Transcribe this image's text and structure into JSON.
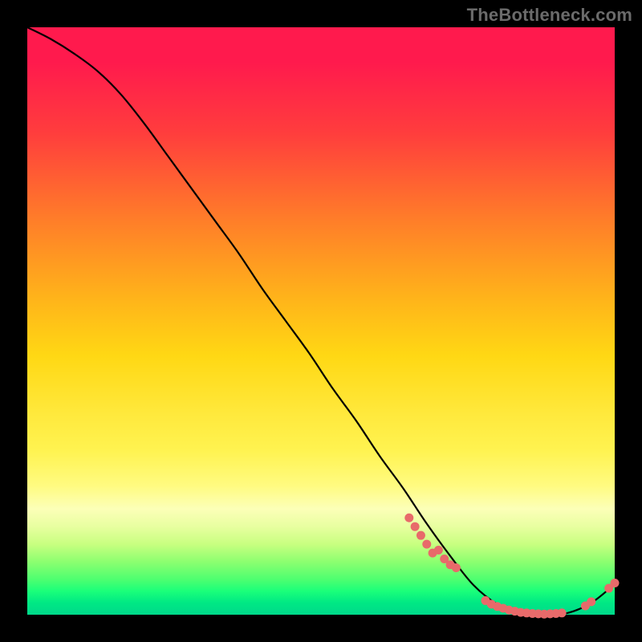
{
  "watermark": "TheBottleneck.com",
  "colors": {
    "curve": "#000000",
    "marker_fill": "#e86a6a",
    "marker_stroke": "#c84a4a",
    "bg": "#000000"
  },
  "chart_data": {
    "type": "line",
    "title": "",
    "xlabel": "",
    "ylabel": "",
    "xlim": [
      0,
      100
    ],
    "ylim": [
      0,
      100
    ],
    "grid": false,
    "legend": false,
    "series": [
      {
        "name": "bottleneck-curve",
        "x": [
          0,
          4,
          8,
          12,
          16,
          20,
          24,
          28,
          32,
          36,
          40,
          44,
          48,
          52,
          56,
          60,
          64,
          68,
          72,
          76,
          80,
          84,
          88,
          92,
          96,
          100
        ],
        "y": [
          100,
          98.0,
          95.5,
          92.5,
          88.5,
          83.5,
          78.0,
          72.5,
          67.0,
          61.5,
          55.5,
          50.0,
          44.5,
          38.5,
          33.0,
          27.0,
          21.5,
          15.5,
          10.0,
          5.0,
          1.8,
          0.2,
          0.0,
          0.3,
          2.0,
          5.2
        ]
      }
    ],
    "markers": [
      {
        "name": "left-cluster-1",
        "x": 65,
        "y": 16.5
      },
      {
        "name": "left-cluster-2",
        "x": 66,
        "y": 15.0
      },
      {
        "name": "left-cluster-3",
        "x": 67,
        "y": 13.5
      },
      {
        "name": "left-cluster-4",
        "x": 68,
        "y": 12.0
      },
      {
        "name": "left-cluster-5a",
        "x": 69,
        "y": 10.5
      },
      {
        "name": "left-cluster-5b",
        "x": 70,
        "y": 11.0
      },
      {
        "name": "left-cluster-6",
        "x": 71,
        "y": 9.5
      },
      {
        "name": "left-cluster-7",
        "x": 72,
        "y": 8.5
      },
      {
        "name": "left-cluster-8",
        "x": 73,
        "y": 8.0
      },
      {
        "name": "bottom-1",
        "x": 78,
        "y": 2.4
      },
      {
        "name": "bottom-2",
        "x": 79,
        "y": 1.8
      },
      {
        "name": "bottom-3",
        "x": 80,
        "y": 1.4
      },
      {
        "name": "bottom-4",
        "x": 81,
        "y": 1.1
      },
      {
        "name": "bottom-5",
        "x": 82,
        "y": 0.8
      },
      {
        "name": "bottom-6",
        "x": 83,
        "y": 0.6
      },
      {
        "name": "bottom-7",
        "x": 84,
        "y": 0.4
      },
      {
        "name": "bottom-8",
        "x": 85,
        "y": 0.3
      },
      {
        "name": "bottom-9",
        "x": 86,
        "y": 0.2
      },
      {
        "name": "bottom-10",
        "x": 87,
        "y": 0.15
      },
      {
        "name": "bottom-11",
        "x": 88,
        "y": 0.1
      },
      {
        "name": "bottom-12",
        "x": 89,
        "y": 0.15
      },
      {
        "name": "bottom-13",
        "x": 90,
        "y": 0.2
      },
      {
        "name": "bottom-14",
        "x": 91,
        "y": 0.3
      },
      {
        "name": "right-rise-1",
        "x": 95,
        "y": 1.5
      },
      {
        "name": "right-rise-2",
        "x": 96,
        "y": 2.2
      },
      {
        "name": "right-end-1",
        "x": 99,
        "y": 4.5
      },
      {
        "name": "right-end-2",
        "x": 100,
        "y": 5.4
      }
    ]
  }
}
